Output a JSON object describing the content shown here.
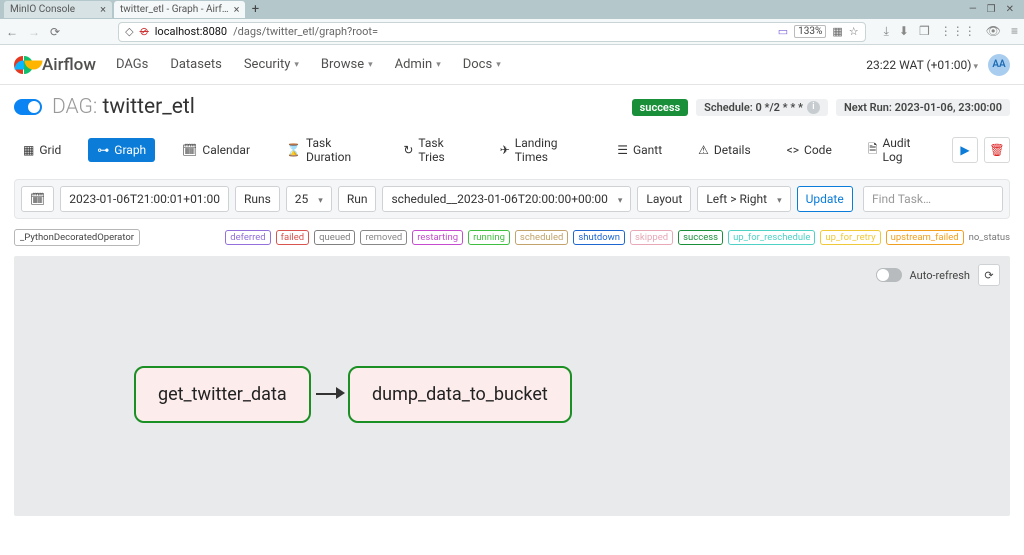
{
  "browser": {
    "tabs": [
      {
        "title": "MinIO Console",
        "active": false
      },
      {
        "title": "twitter_etl - Graph - Airf…",
        "active": true
      }
    ],
    "url_prefix": "localhost:8080",
    "url_path": "/dags/twitter_etl/graph?root=",
    "zoom": "133%"
  },
  "header": {
    "brand": "Airflow",
    "nav": [
      "DAGs",
      "Datasets",
      "Security",
      "Browse",
      "Admin",
      "Docs"
    ],
    "nav_caret": [
      false,
      false,
      true,
      true,
      true,
      true
    ],
    "time": "23:22 WAT (+01:00)",
    "user_initials": "AA"
  },
  "dag": {
    "label": "DAG:",
    "name": "twitter_etl",
    "status_badge": "success",
    "schedule_label": "Schedule: 0 */2 * * *",
    "next_run": "Next Run: 2023-01-06, 23:00:00"
  },
  "views": [
    "Grid",
    "Graph",
    "Calendar",
    "Task Duration",
    "Task Tries",
    "Landing Times",
    "Gantt",
    "Details",
    "Code",
    "Audit Log"
  ],
  "controls": {
    "date": "2023-01-06T21:00:01+01:00",
    "runs_label": "Runs",
    "runs_value": "25",
    "run_label": "Run",
    "run_value": "scheduled__2023-01-06T20:00:00+00:00",
    "layout_label": "Layout",
    "layout_value": "Left > Right",
    "update": "Update",
    "search_placeholder": "Find Task…"
  },
  "operator_badge": "_PythonDecoratedOperator",
  "statuses": [
    {
      "name": "deferred",
      "color": "#9370db"
    },
    {
      "name": "failed",
      "color": "#d9534f"
    },
    {
      "name": "queued",
      "color": "#808080"
    },
    {
      "name": "removed",
      "color": "#888"
    },
    {
      "name": "restarting",
      "color": "#c54ccf"
    },
    {
      "name": "running",
      "color": "#3fbf3f"
    },
    {
      "name": "scheduled",
      "color": "#c2a36b"
    },
    {
      "name": "shutdown",
      "color": "#1e66d0"
    },
    {
      "name": "skipped",
      "color": "#e8a8b8"
    },
    {
      "name": "success",
      "color": "#1a8f3a"
    },
    {
      "name": "up_for_reschedule",
      "color": "#4fd1c5"
    },
    {
      "name": "up_for_retry",
      "color": "#f0c93a"
    },
    {
      "name": "upstream_failed",
      "color": "#f0a020"
    }
  ],
  "no_status": "no_status",
  "auto_refresh": "Auto-refresh",
  "tasks": [
    "get_twitter_data",
    "dump_data_to_bucket"
  ]
}
